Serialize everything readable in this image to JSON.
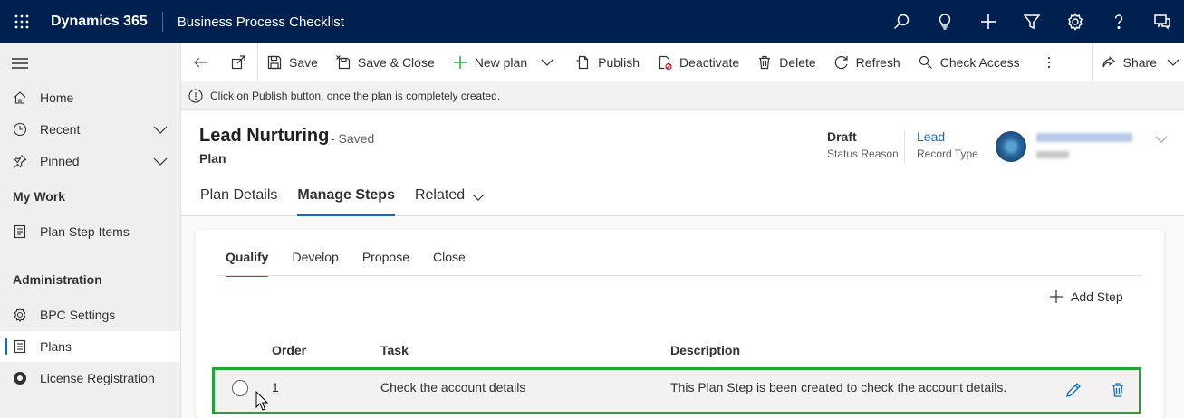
{
  "app": {
    "name": "Dynamics 365",
    "title": "Business Process Checklist"
  },
  "top_icons": [
    "search-icon",
    "lightbulb-icon",
    "plus-icon",
    "filter-icon",
    "gear-icon",
    "help-icon",
    "chat-icon"
  ],
  "sidebar": {
    "items": [
      {
        "label": "Home",
        "icon": "home-icon"
      },
      {
        "label": "Recent",
        "icon": "clock-icon"
      },
      {
        "label": "Pinned",
        "icon": "pin-icon"
      }
    ],
    "section_mywork": "My Work",
    "mywork_items": [
      {
        "label": "Plan Step Items",
        "icon": "checklist-icon"
      }
    ],
    "section_admin": "Administration",
    "admin_items": [
      {
        "label": "BPC Settings",
        "icon": "gear-icon"
      },
      {
        "label": "Plans",
        "icon": "document-icon"
      },
      {
        "label": "License Registration",
        "icon": "license-icon"
      }
    ]
  },
  "commands": {
    "save": "Save",
    "save_close": "Save & Close",
    "new_plan": "New plan",
    "publish": "Publish",
    "deactivate": "Deactivate",
    "delete": "Delete",
    "refresh": "Refresh",
    "check_access": "Check Access",
    "share": "Share"
  },
  "notification": "Click on Publish button, once the plan is completely created.",
  "record": {
    "title": "Lead Nurturing",
    "saved_state": "- Saved",
    "entity": "Plan",
    "status_value": "Draft",
    "status_label": "Status Reason",
    "type_value": "Lead",
    "type_label": "Record Type"
  },
  "tabs": {
    "details": "Plan Details",
    "steps": "Manage Steps",
    "related": "Related"
  },
  "stages": [
    "Qualify",
    "Develop",
    "Propose",
    "Close"
  ],
  "add_step": "Add Step",
  "grid": {
    "headers": {
      "order": "Order",
      "task": "Task",
      "description": "Description"
    },
    "rows": [
      {
        "order": "1",
        "task": "Check the account details",
        "description": "This Plan Step is been created to check the account details."
      }
    ]
  },
  "colors": {
    "topbar": "#002050",
    "accent": "#0f6cbd",
    "row_highlight": "#21a336"
  }
}
